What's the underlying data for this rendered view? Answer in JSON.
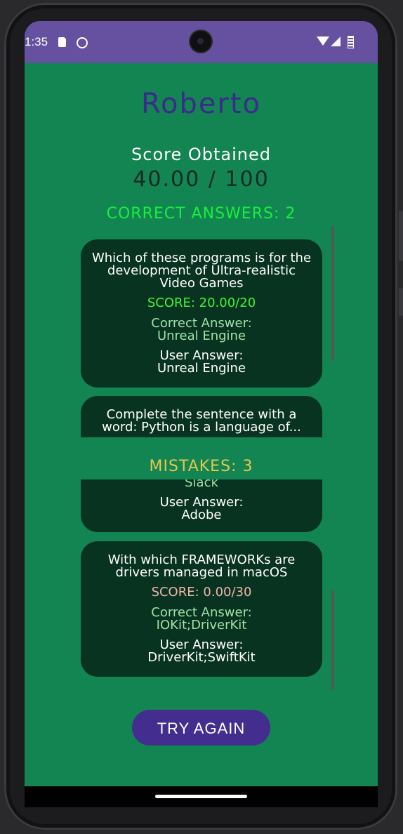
{
  "status_bar": {
    "time": "1:35"
  },
  "header": {
    "user_name": "Roberto",
    "score_label": "Score Obtained",
    "score_value": "40.00 / 100"
  },
  "correct": {
    "title": "CORRECT ANSWERS: 2",
    "cards": [
      {
        "question": "Which of these programs is for the development of Ultra-realistic Video Games",
        "score": "SCORE: 20.00/20",
        "correct_label": "Correct Answer:",
        "correct_value": "Unreal Engine",
        "user_label": "User Answer:",
        "user_value": "Unreal Engine"
      },
      {
        "question": "Complete the sentence with a word: Python is a language of..."
      }
    ]
  },
  "mistakes": {
    "title": "MISTAKES: 3",
    "cards": [
      {
        "correct_value": "Slack",
        "user_label": "User Answer:",
        "user_value": "Adobe"
      },
      {
        "question": "With which FRAMEWORKs are drivers managed in macOS",
        "score": "SCORE: 0.00/30",
        "correct_label": "Correct Answer:",
        "correct_value": "IOKit;DriverKit",
        "user_label": "User Answer:",
        "user_value": "DriverKit;SwiftKit"
      }
    ]
  },
  "actions": {
    "try_again": "TRY AGAIN"
  },
  "colors": {
    "status_bar": "#6551a0",
    "background": "#128552",
    "card": "#083321",
    "user_name": "#3b2b8c",
    "correct_title": "#1aee3a",
    "mistakes_title": "#e8c64a",
    "button": "#432d8f"
  },
  "icons": [
    "sd-card-icon",
    "face-icon",
    "front-camera",
    "wifi-icon",
    "signal-icon",
    "battery-icon",
    "home-indicator"
  ]
}
